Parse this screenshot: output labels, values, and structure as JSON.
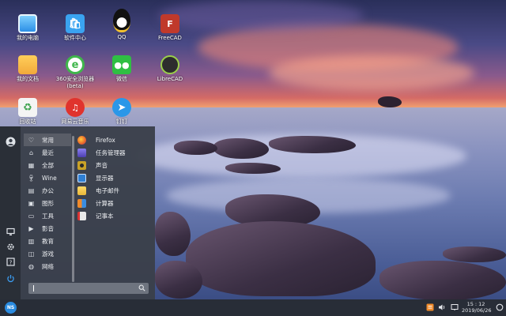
{
  "desktop": {
    "icons": [
      {
        "label": "我的电脑",
        "icon": "computer-icon",
        "color": "#2b8fe6"
      },
      {
        "label": "软件中心",
        "icon": "software-center-icon",
        "color": "#3aa3f0"
      },
      {
        "label": "QQ",
        "icon": "qq-penguin-icon",
        "color": "#111111"
      },
      {
        "label": "FreeCAD",
        "icon": "freecad-icon",
        "color": "#c0392b"
      },
      {
        "label": "我的文档",
        "icon": "folder-icon",
        "color": "#f2a93b"
      },
      {
        "label": "360安全浏览器 (beta)",
        "icon": "browser-360-icon",
        "color": "#3fb64b"
      },
      {
        "label": "微信",
        "icon": "wechat-icon",
        "color": "#2fbf43"
      },
      {
        "label": "LibreCAD",
        "icon": "librecad-icon",
        "color": "#2d2d2d"
      },
      {
        "label": "回收站",
        "icon": "trash-icon",
        "color": "#f4f4f4"
      },
      {
        "label": "网易云音乐",
        "icon": "netease-music-icon",
        "color": "#e0332d"
      },
      {
        "label": "钉钉",
        "icon": "dingtalk-icon",
        "color": "#2a97e8"
      }
    ]
  },
  "start_menu": {
    "rail": [
      "user-avatar-icon",
      "display-icon",
      "settings-icon",
      "help-icon",
      "power-icon"
    ],
    "categories": [
      {
        "label": "常用",
        "icon": "heart-icon"
      },
      {
        "label": "最近",
        "icon": "home-icon"
      },
      {
        "label": "全部",
        "icon": "grid-icon"
      },
      {
        "label": "Wine",
        "icon": "wine-icon"
      },
      {
        "label": "办公",
        "icon": "document-icon"
      },
      {
        "label": "图形",
        "icon": "image-icon"
      },
      {
        "label": "工具",
        "icon": "toolbox-icon"
      },
      {
        "label": "影音",
        "icon": "media-icon"
      },
      {
        "label": "教育",
        "icon": "book-icon"
      },
      {
        "label": "游戏",
        "icon": "gamepad-icon"
      },
      {
        "label": "网络",
        "icon": "globe-icon"
      }
    ],
    "selected_category": "常用",
    "apps": [
      {
        "label": "Firefox",
        "icon": "firefox-icon",
        "color": "#e8642a"
      },
      {
        "label": "任务管理器",
        "icon": "task-manager-icon",
        "color": "#6a5acd"
      },
      {
        "label": "声音",
        "icon": "sound-icon",
        "color": "#c9a227"
      },
      {
        "label": "显示器",
        "icon": "monitor-icon",
        "color": "#2f7fd3"
      },
      {
        "label": "电子邮件",
        "icon": "email-icon",
        "color": "#e8b73a"
      },
      {
        "label": "计算器",
        "icon": "calculator-icon",
        "color": "#f08a2a"
      },
      {
        "label": "记事本",
        "icon": "notepad-icon",
        "color": "#e9e9e9"
      }
    ],
    "search": {
      "value": "",
      "placeholder": ""
    }
  },
  "taskbar": {
    "start_label": "NS",
    "tray": [
      "app-tray-icon",
      "volume-icon",
      "notification-icon"
    ],
    "clock": {
      "time": "15 : 12",
      "date": "2019/06/26"
    },
    "show_desktop": "show-desktop-icon"
  }
}
